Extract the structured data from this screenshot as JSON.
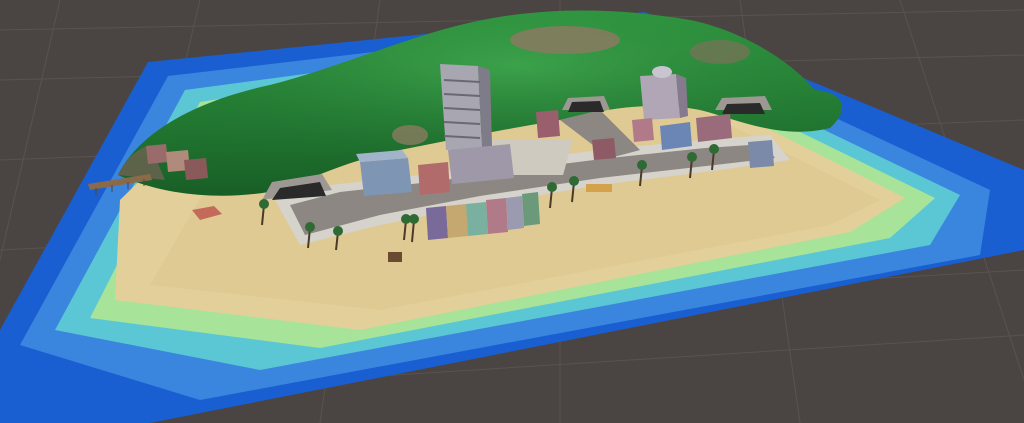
{
  "viewport": {
    "view": "scene-view",
    "projection": "perspective",
    "grid_visible": true
  },
  "scene": {
    "name": "island-town",
    "colors": {
      "background": "#4a4542",
      "grid_line": "#5a5552",
      "deep_water": "#1a5fd1",
      "mid_water": "#3f8fe0",
      "shallow_water": "#5fd6c8",
      "foam": "#b9e89a",
      "sand": "#e3cf9a",
      "hill_dark": "#1f7a2e",
      "hill_light": "#3aa04a",
      "rock": "#8a7a60",
      "road": "#8c8782",
      "sidewalk": "#d6d3cc",
      "tunnel": "#2a2a2a"
    },
    "objects": [
      {
        "name": "west-pier",
        "type": "pier"
      },
      {
        "name": "west-cliff-houses",
        "type": "building-cluster"
      },
      {
        "name": "west-tunnel",
        "type": "tunnel"
      },
      {
        "name": "tall-apartment-tower",
        "type": "building"
      },
      {
        "name": "hilltop-tower",
        "type": "building"
      },
      {
        "name": "east-tunnel",
        "type": "tunnel"
      },
      {
        "name": "north-tunnel",
        "type": "tunnel"
      },
      {
        "name": "beachfront-row-houses",
        "type": "building-cluster"
      },
      {
        "name": "town-square-plaza",
        "type": "plaza"
      },
      {
        "name": "coastal-road",
        "type": "road"
      },
      {
        "name": "palm-trees",
        "type": "vegetation"
      },
      {
        "name": "beach-hut",
        "type": "prop"
      },
      {
        "name": "small-boat",
        "type": "prop"
      }
    ]
  }
}
